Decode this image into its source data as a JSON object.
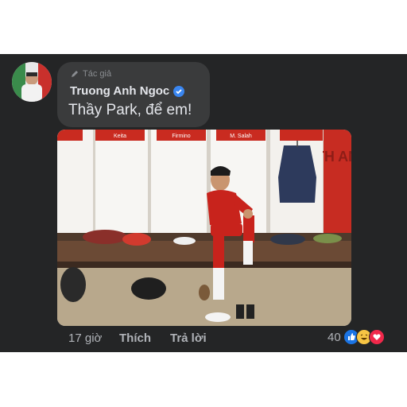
{
  "comment": {
    "author_tag": "Tác giả",
    "author_name": "Truong Anh Ngoc",
    "text": "Thầy Park, để em!",
    "timestamp": "17 giờ",
    "like_label": "Thích",
    "reply_label": "Trả lời",
    "reaction_count": "40"
  },
  "photo": {
    "locker_names": [
      "Keita",
      "Firmino",
      "M. Salah"
    ],
    "wall_text": "TH AN"
  },
  "icons": {
    "author_tag_icon": "pencil-icon",
    "verified_icon": "verified-badge-icon",
    "reactions": [
      "like-reaction-icon",
      "haha-reaction-icon",
      "love-reaction-icon"
    ]
  },
  "colors": {
    "panel_bg": "#242526",
    "bubble_bg": "#3a3b3c",
    "text_primary": "#e4e6eb",
    "text_secondary": "#b0b3b8",
    "verified_blue": "#3a86f0"
  }
}
